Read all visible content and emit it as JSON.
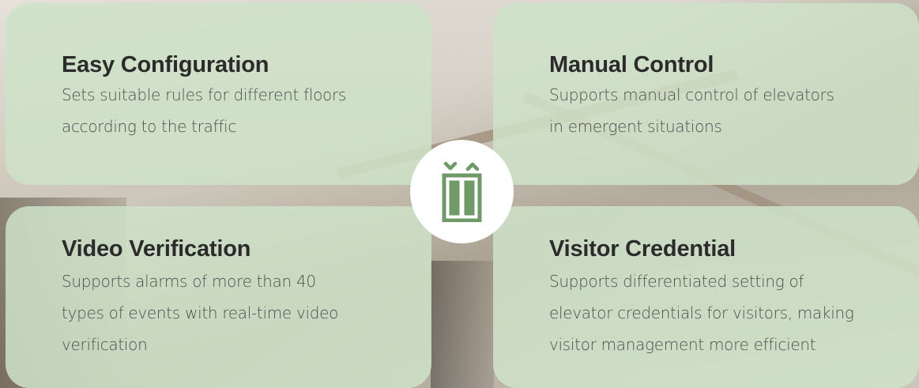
{
  "cards": [
    {
      "title": "Easy Configuration",
      "lines": [
        "Sets suitable rules for different floors",
        "according to the traffic"
      ]
    },
    {
      "title": "Manual Control",
      "lines": [
        "Supports manual control of elevators",
        "in emergent situations"
      ]
    },
    {
      "title": "Video Verification",
      "lines": [
        "Supports alarms of more than 40",
        "types of events  with real-time video",
        "verification"
      ]
    },
    {
      "title": "Visitor Credential",
      "lines": [
        "Supports differentiated setting of",
        "elevator credentials for visitors, making",
        "visitor management more efficient"
      ]
    }
  ],
  "center_icon": {
    "name": "elevator-icon",
    "color": "#6f9a68"
  },
  "colors": {
    "card_background": "#cee2c8",
    "title_text": "#2b2b2b",
    "body_text": "#4e4e4e"
  }
}
